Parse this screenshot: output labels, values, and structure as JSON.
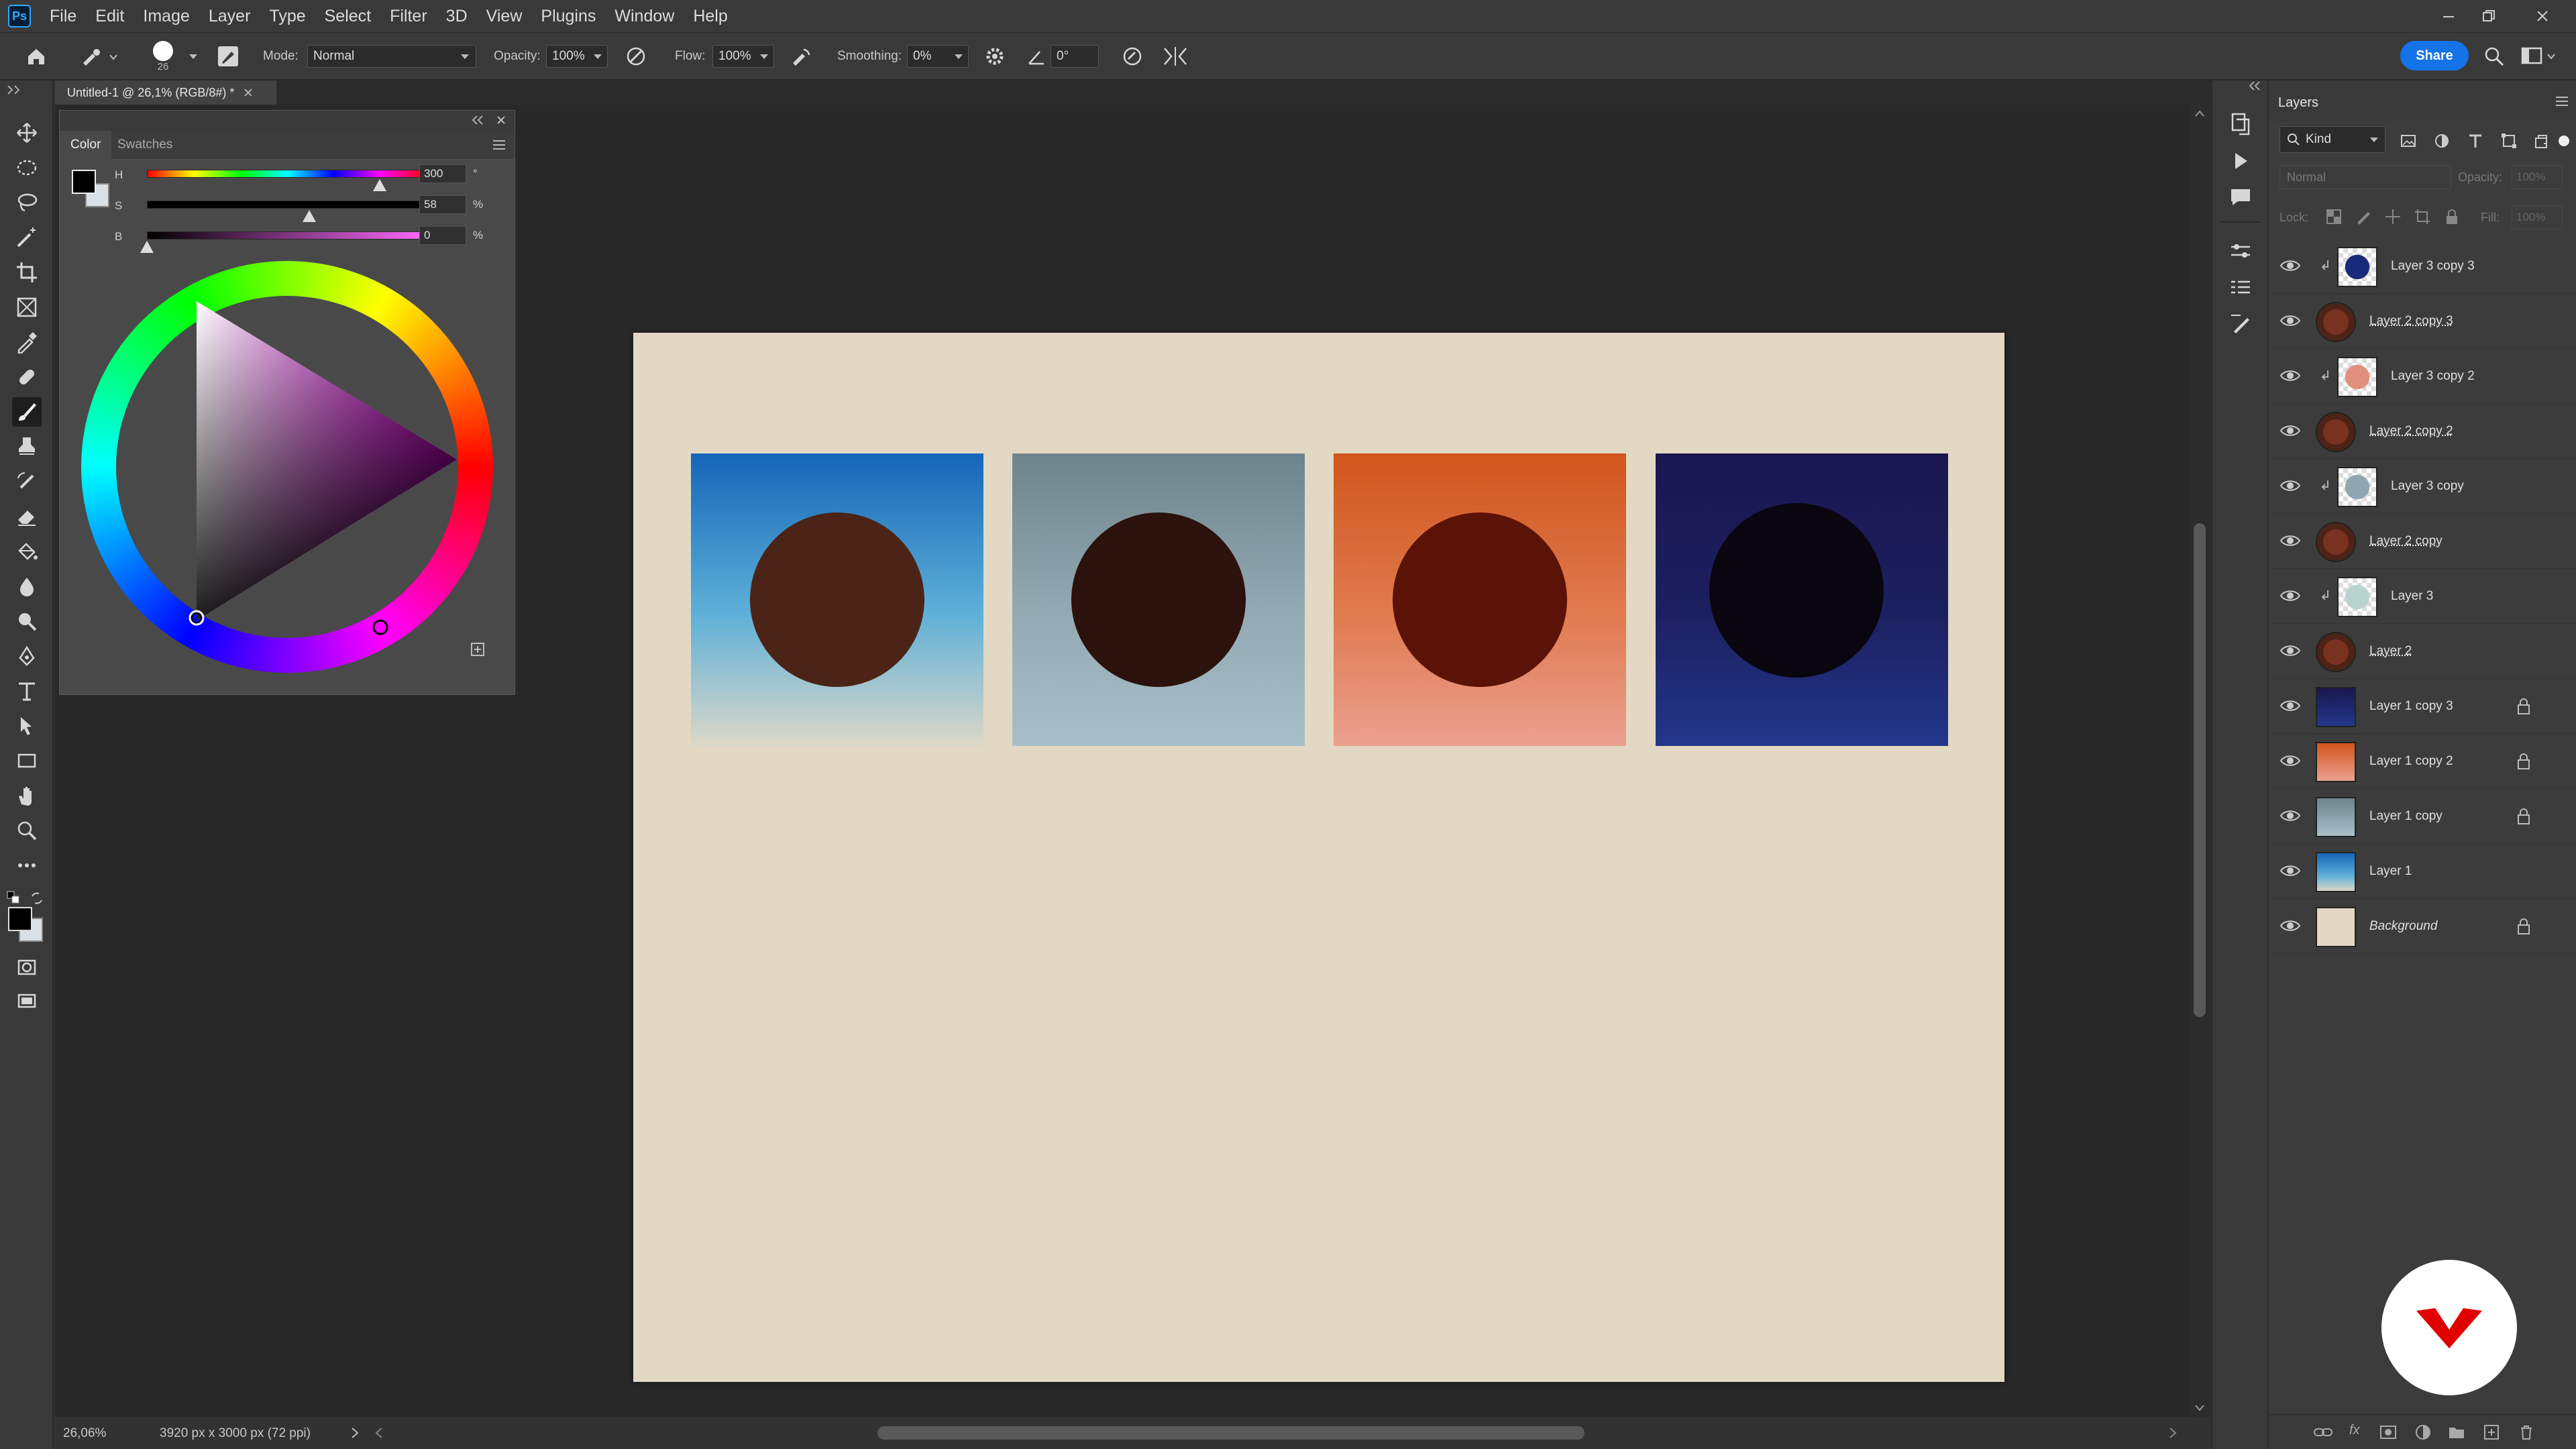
{
  "app": {
    "logo": "Ps"
  },
  "menubar": {
    "items": [
      "File",
      "Edit",
      "Image",
      "Layer",
      "Type",
      "Select",
      "Filter",
      "3D",
      "View",
      "Plugins",
      "Window",
      "Help"
    ]
  },
  "options_bar": {
    "brush_size": "26",
    "mode_label": "Mode:",
    "mode_value": "Normal",
    "opacity_label": "Opacity:",
    "opacity_value": "100%",
    "flow_label": "Flow:",
    "flow_value": "100%",
    "smoothing_label": "Smoothing:",
    "smoothing_value": "0%",
    "angle_value": "0°",
    "share_label": "Share"
  },
  "document": {
    "tab_title": "Untitled-1 @ 26,1% (RGB/8#) *"
  },
  "color_panel": {
    "tabs": [
      "Color",
      "Swatches"
    ],
    "h_label": "H",
    "h_value": "300",
    "h_unit": "°",
    "s_label": "S",
    "s_value": "58",
    "s_unit": "%",
    "b_label": "B",
    "b_value": "0",
    "b_unit": "%",
    "h_fraction": 0.83,
    "s_fraction": 0.58,
    "b_fraction": 0.0,
    "foreground": "#000000",
    "background": "#d9e1e6"
  },
  "canvas": {
    "background": "#e3d8c4",
    "tiles": [
      {
        "name": "tile-blue",
        "sky_top": "#1466b8",
        "sky_mid": "#5fb0d8",
        "sky_bottom": "#dcd8c8",
        "sun": "#4b2417"
      },
      {
        "name": "tile-grey",
        "sky_top": "#6e848c",
        "sky_mid": "#93aab4",
        "sky_bottom": "#a8bfc9",
        "sun": "#2c120c"
      },
      {
        "name": "tile-orange",
        "sky_top": "#d0561c",
        "sky_mid": "#e07a50",
        "sky_bottom": "#eaa090",
        "sun": "#5a1306"
      },
      {
        "name": "tile-navy",
        "sky_top": "#1a1650",
        "sky_mid": "#1c2060",
        "sky_bottom": "#23368a",
        "sun": "#0a0610"
      }
    ]
  },
  "status_bar": {
    "zoom": "26,06%",
    "doc_info": "3920 px x 3000 px (72 ppi)"
  },
  "layers_panel": {
    "title": "Layers",
    "filter_kind": "Kind",
    "blend_mode": "Normal",
    "opacity_label": "Opacity:",
    "opacity_value": "100%",
    "lock_label": "Lock:",
    "fill_label": "Fill:",
    "fill_value": "100%",
    "layers": [
      {
        "name": "Layer 3 copy 3",
        "thumb": "sun-navy",
        "clipped": true,
        "linked_style": false,
        "locked": false
      },
      {
        "name": "Layer 2 copy 3",
        "thumb": "sun-brown",
        "clipped": false,
        "linked_style": true,
        "locked": false
      },
      {
        "name": "Layer 3 copy 2",
        "thumb": "sun-peach",
        "clipped": true,
        "linked_style": false,
        "locked": false
      },
      {
        "name": "Layer 2 copy 2",
        "thumb": "sun-brown",
        "clipped": false,
        "linked_style": true,
        "locked": false
      },
      {
        "name": "Layer 3 copy",
        "thumb": "sun-grey",
        "clipped": true,
        "linked_style": false,
        "locked": false
      },
      {
        "name": "Layer 2 copy",
        "thumb": "sun-brown",
        "clipped": false,
        "linked_style": true,
        "locked": false
      },
      {
        "name": "Layer 3",
        "thumb": "sun-pale",
        "clipped": true,
        "linked_style": false,
        "locked": false
      },
      {
        "name": "Layer 2",
        "thumb": "sun-brown",
        "clipped": false,
        "linked_style": true,
        "locked": false
      },
      {
        "name": "Layer 1 copy 3",
        "thumb": "grad-navy",
        "clipped": false,
        "linked_style": false,
        "locked": true
      },
      {
        "name": "Layer 1 copy 2",
        "thumb": "grad-orange",
        "clipped": false,
        "linked_style": false,
        "locked": true
      },
      {
        "name": "Layer 1 copy",
        "thumb": "grad-grey",
        "clipped": false,
        "linked_style": false,
        "locked": true
      },
      {
        "name": "Layer 1",
        "thumb": "grad-blue",
        "clipped": false,
        "linked_style": false,
        "locked": false
      },
      {
        "name": "Background",
        "thumb": "solid-beige",
        "clipped": false,
        "linked_style": false,
        "locked": true,
        "italic": true
      }
    ]
  }
}
